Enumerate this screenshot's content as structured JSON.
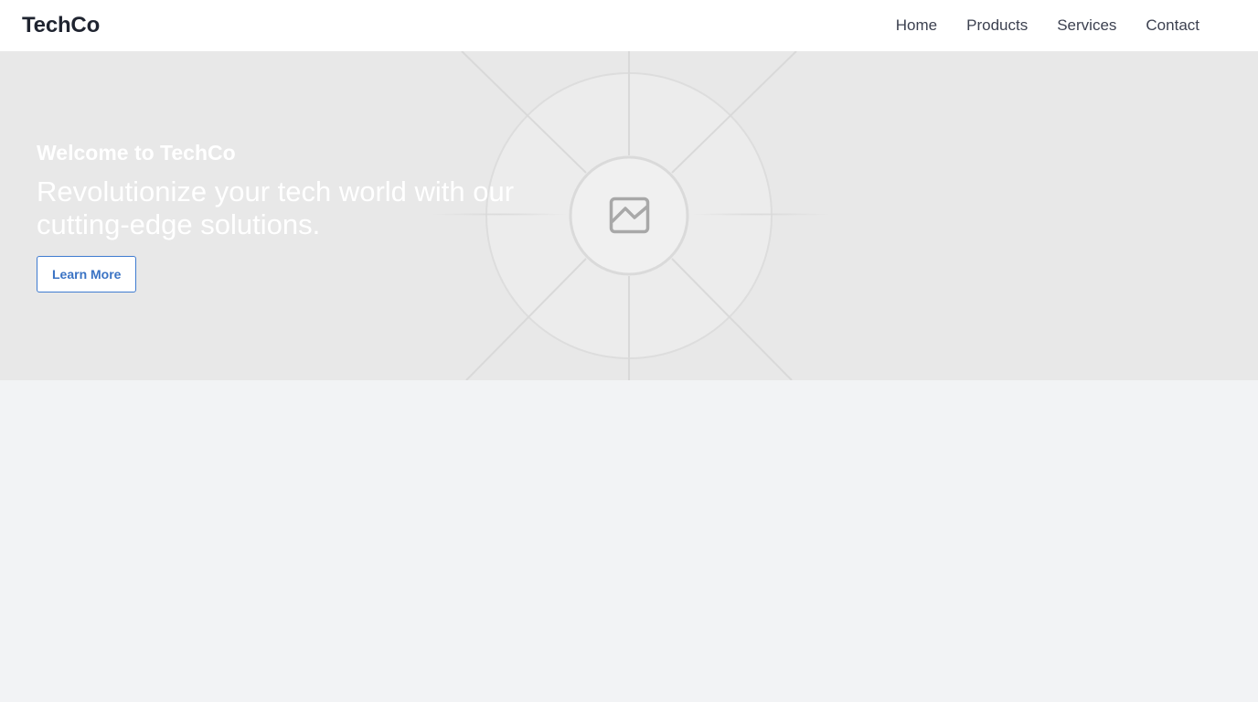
{
  "header": {
    "logo": "TechCo",
    "nav": [
      {
        "label": "Home"
      },
      {
        "label": "Products"
      },
      {
        "label": "Services"
      },
      {
        "label": "Contact"
      }
    ]
  },
  "hero": {
    "title": "Welcome to TechCo",
    "subtitle": "Revolutionize your tech world with our cutting-edge solutions.",
    "button_label": "Learn More",
    "image_icon": "image-placeholder-icon"
  },
  "colors": {
    "header_bg": "#ffffff",
    "hero_bg": "#e8e8e8",
    "page_bg": "#f2f3f5",
    "accent": "#3f7bd0",
    "text_dark": "#1f2430"
  }
}
